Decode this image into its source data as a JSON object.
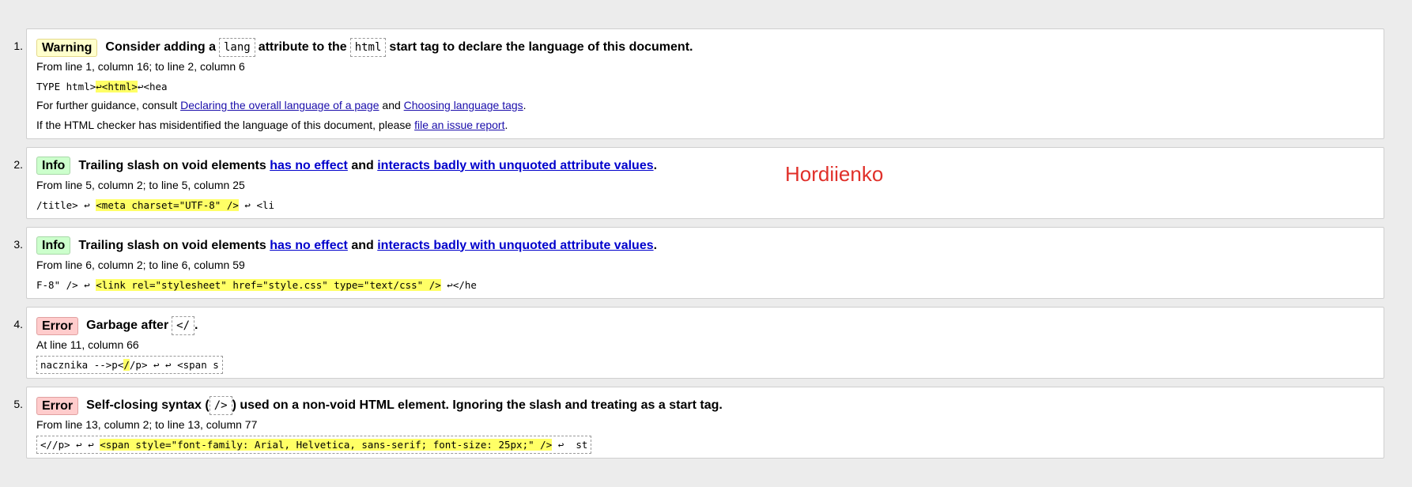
{
  "messages": [
    {
      "index": "1.",
      "type": "Warning",
      "title_pre": "Consider adding a",
      "code1": "lang",
      "title_mid": "attribute to the",
      "code2": "html",
      "title_post": "start tag to declare the language of this document.",
      "location": "From line 1, column 16; to line 2, column 6",
      "extract_pre": "TYPE html>",
      "extract_hl": "↩<html>",
      "extract_post": "↩<hea",
      "guidance_pre": "For further guidance, consult",
      "guidance_link1": "Declaring the overall language of a page",
      "guidance_and": "and",
      "guidance_link2": "Choosing language tags",
      "guidance_end": ".",
      "misid_pre": "If the HTML checker has misidentified the language of this document, please",
      "misid_link": "file an issue report",
      "misid_end": "."
    },
    {
      "index": "2.",
      "type": "Info",
      "title_pre": "Trailing slash on void elements",
      "link1": "has no effect",
      "title_and": "and",
      "link2": "interacts badly with unquoted attribute values",
      "title_end": ".",
      "location": "From line 5, column 2; to line 5, column 25",
      "extract_pre": "/title> ↩ ",
      "extract_hl": "<meta charset=\"UTF-8\" />",
      "extract_post": " ↩ <li"
    },
    {
      "index": "3.",
      "type": "Info",
      "title_pre": "Trailing slash on void elements",
      "link1": "has no effect",
      "title_and": "and",
      "link2": "interacts badly with unquoted attribute values",
      "title_end": ".",
      "location": "From line 6, column 2; to line 6, column 59",
      "extract_pre": "F-8\" /> ↩ ",
      "extract_hl": "<link rel=\"stylesheet\" href=\"style.css\" type=\"text/css\" />",
      "extract_post": " ↩</he"
    },
    {
      "index": "4.",
      "type": "Error",
      "title_pre": "Garbage after",
      "code1": "</",
      "title_end": ".",
      "location": "At line 11, column 66",
      "extract_pre": "nacznika -->p<",
      "extract_hl": "/",
      "extract_post": "/p> ↩ ↩ <span s"
    },
    {
      "index": "5.",
      "type": "Error",
      "title_pre": "Self-closing syntax (",
      "code1": "/>",
      "title_post": ") used on a non-void HTML element. Ignoring the slash and treating as a start tag.",
      "location": "From line 13, column 2; to line 13, column 77",
      "extract_pre": "<//p> ↩ ↩ ",
      "extract_hl": "<span style=\"font-family: Arial, Helvetica, sans-serif; font-size: 25px;\" />",
      "extract_post": " ↩  st"
    }
  ],
  "overlay_text": "Hordiienko",
  "colors": {
    "warning_bg": "#ffffcc",
    "info_bg": "#ccffcc",
    "error_bg": "#ffcccc",
    "highlight": "#ffff66",
    "link": "#0000cc",
    "overlay": "#e0302a"
  }
}
